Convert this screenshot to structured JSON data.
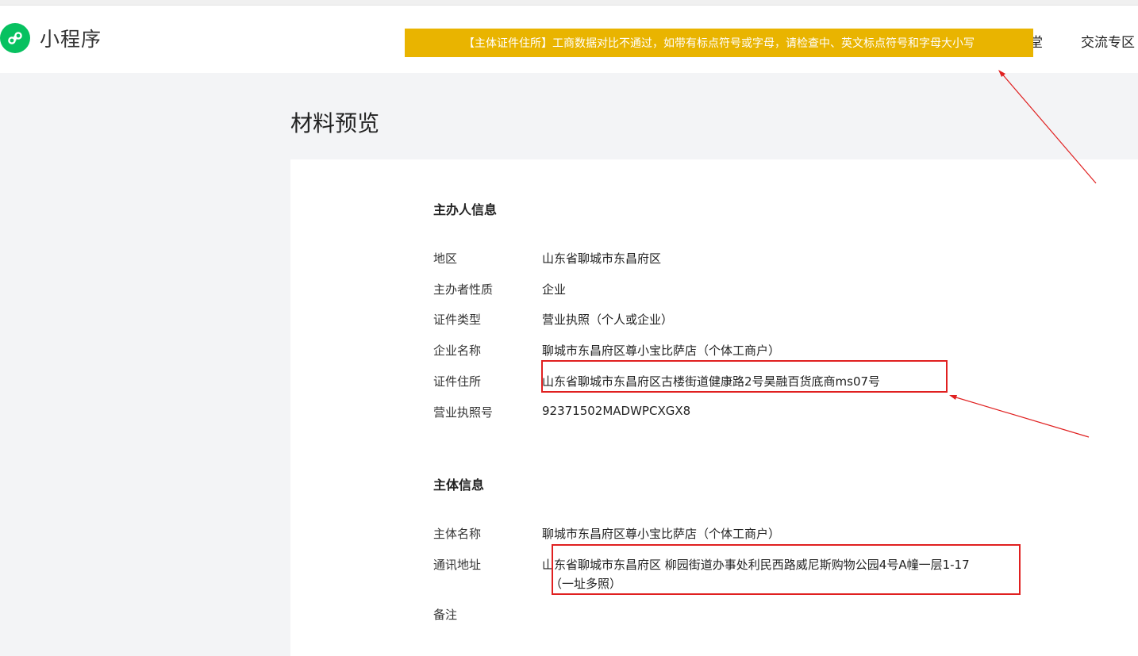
{
  "header": {
    "app_name": "小程序",
    "nav": [
      "堂",
      "交流专区"
    ]
  },
  "toast": {
    "message": "【主体证件住所】工商数据对比不通过，如带有标点符号或字母，请检查中、英文标点符号和字母大小写"
  },
  "page": {
    "title": "材料预览"
  },
  "sponsor_section": {
    "title": "主办人信息",
    "fields": [
      {
        "label": "地区",
        "value": "山东省聊城市东昌府区"
      },
      {
        "label": "主办者性质",
        "value": "企业"
      },
      {
        "label": "证件类型",
        "value": "营业执照（个人或企业）"
      },
      {
        "label": "企业名称",
        "value": "聊城市东昌府区尊小宝比萨店（个体工商户）"
      },
      {
        "label": "证件住所",
        "value": "山东省聊城市东昌府区古楼街道健康路2号昊融百货底商ms07号"
      },
      {
        "label": "营业执照号",
        "value": "92371502MADWPCXGX8"
      }
    ]
  },
  "entity_section": {
    "title": "主体信息",
    "fields": [
      {
        "label": "主体名称",
        "value": "聊城市东昌府区尊小宝比萨店（个体工商户）"
      },
      {
        "label": "通讯地址",
        "value": "山东省聊城市东昌府区 柳园街道办事处利民西路威尼斯购物公园4号A幢一层1-17",
        "value_line2": "（一址多照）"
      },
      {
        "label": "备注",
        "value": ""
      }
    ]
  },
  "colors": {
    "toast_bg": "#e9b400",
    "brand_green": "#07c160",
    "annotation_red": "#e02020"
  },
  "icons": {
    "logo": "miniprogram-logo-icon"
  }
}
